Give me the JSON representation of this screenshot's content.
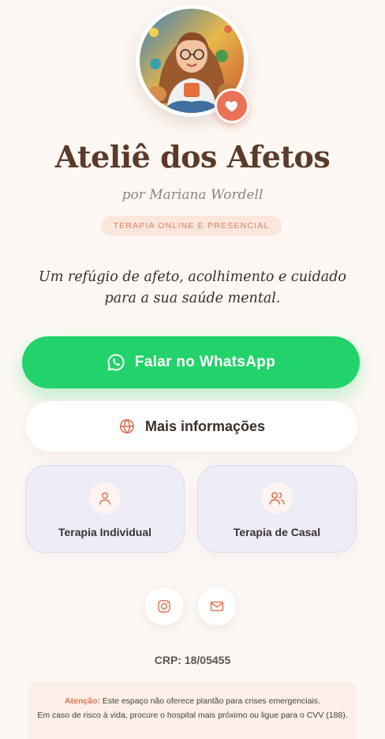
{
  "profile": {
    "title": "Ateliê dos Afetos",
    "byline": "por Mariana Wordell",
    "badge": "TERAPIA ONLINE E PRESENCIAL",
    "tagline": "Um refúgio de afeto, acolhimento e cuidado para a sua saúde mental."
  },
  "actions": {
    "whatsapp_label": "Falar no WhatsApp",
    "info_label": "Mais informações"
  },
  "services": [
    {
      "label": "Terapia Individual",
      "icon": "user-icon"
    },
    {
      "label": "Terapia de Casal",
      "icon": "users-icon"
    }
  ],
  "social": {
    "instagram_icon": "instagram-icon",
    "email_icon": "mail-icon"
  },
  "footer": {
    "crp": "CRP: 18/05455",
    "notice_label": "Atenção:",
    "notice_line1": " Este espaço não oferece plantão para crises emergenciais.",
    "notice_line2": "Em caso de risco à vida, procure o hospital mais próximo ou ligue para o CVV (188)."
  },
  "colors": {
    "background": "#fdf8f4",
    "accent": "#ea7357",
    "whatsapp": "#21d36a",
    "title": "#5a3b2a",
    "card": "#eeecf7"
  }
}
